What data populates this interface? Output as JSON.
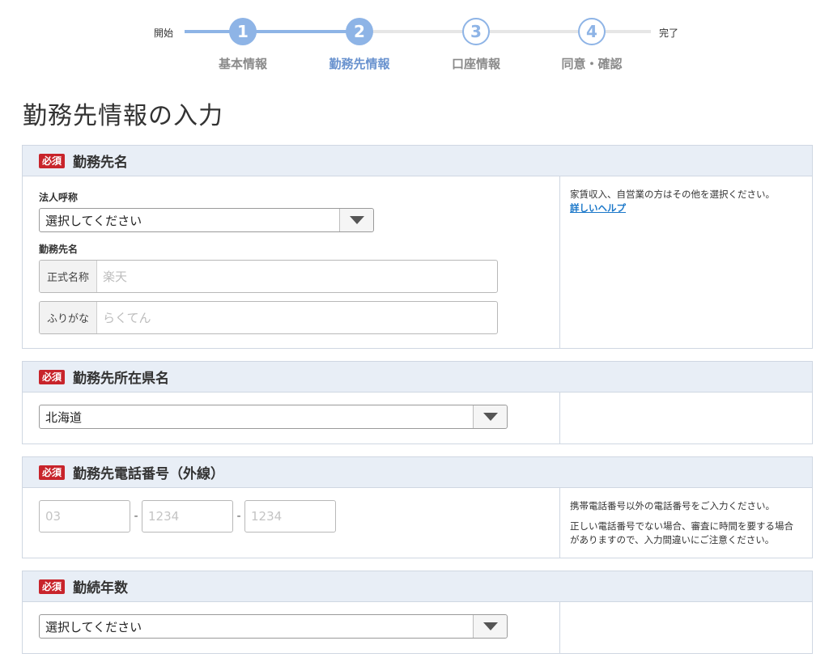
{
  "progress": {
    "start_label": "開始",
    "end_label": "完了",
    "steps": [
      {
        "number": "1",
        "label": "基本情報",
        "state": "done"
      },
      {
        "number": "2",
        "label": "勤務先情報",
        "state": "current"
      },
      {
        "number": "3",
        "label": "口座情報",
        "state": "todo"
      },
      {
        "number": "4",
        "label": "同意・確認",
        "state": "todo"
      }
    ]
  },
  "page_title": "勤務先情報の入力",
  "required_badge": "必須",
  "sections": {
    "employer_name": {
      "title": "勤務先名",
      "corp_title_label": "法人呼称",
      "corp_title_value": "選択してください",
      "employer_label": "勤務先名",
      "official_prefix": "正式名称",
      "official_placeholder": "楽天",
      "kana_prefix": "ふりがな",
      "kana_placeholder": "らくてん",
      "help_text": "家賃収入、自営業の方はその他を選択ください。",
      "help_link": "詳しいヘルプ"
    },
    "prefecture": {
      "title": "勤務先所在県名",
      "value": "北海道"
    },
    "phone": {
      "title": "勤務先電話番号（外線）",
      "part1_placeholder": "03",
      "part2_placeholder": "1234",
      "part3_placeholder": "1234",
      "dash": "-",
      "help_text_1": "携帯電話番号以外の電話番号をご入力ください。",
      "help_text_2": "正しい電話番号でない場合、審査に時間を要する場合がありますので、入力間違いにご注意ください。"
    },
    "years": {
      "title": "勤続年数",
      "value": "選択してください"
    }
  },
  "colors": {
    "accent": "#8eb4e6",
    "required": "#c8242b",
    "header_bg": "#e8eef6",
    "link": "#1a77c9"
  }
}
